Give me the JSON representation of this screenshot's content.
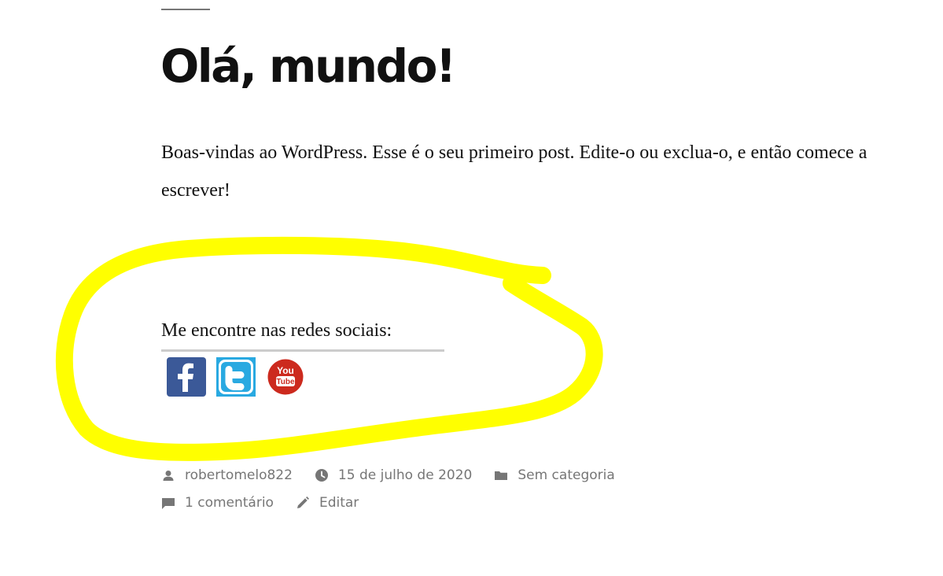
{
  "post": {
    "title": "Olá, mundo!",
    "content": "Boas-vindas ao WordPress. Esse é o seu primeiro post. Edite-o ou exclua-o, e então comece a escrever!"
  },
  "social": {
    "heading": "Me encontre nas redes sociais:",
    "links": [
      {
        "name": "facebook",
        "icon": "facebook-icon",
        "color": "#3b5998"
      },
      {
        "name": "twitter",
        "icon": "twitter-icon",
        "color": "#29a9e1"
      },
      {
        "name": "youtube",
        "icon": "youtube-icon",
        "color": "#cc2a1e",
        "text_top": "You",
        "text_bottom": "Tube"
      }
    ]
  },
  "meta": {
    "author": "robertomelo822",
    "date": "15 de julho de 2020",
    "category": "Sem categoria",
    "comments": "1 comentário",
    "edit": "Editar"
  },
  "colors": {
    "highlight": "#ffff00",
    "meta_text": "#767676",
    "title": "#111111"
  }
}
